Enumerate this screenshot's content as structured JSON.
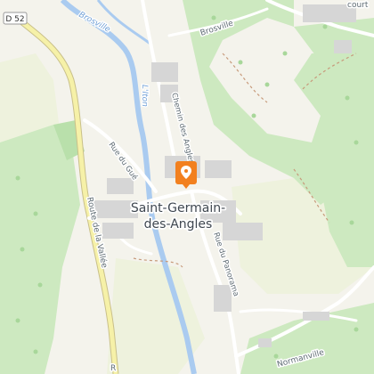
{
  "map": {
    "road_shield": "D 52",
    "place_name_line1": "Saint-Germain-",
    "place_name_line2": "des-Angles",
    "river_label": "L'Iton",
    "streets": {
      "chemin_des_angles": "Chemin des Angles",
      "rue_du_gue": "Rue du Gué",
      "route_de_la_vallee": "Route de la Vallée",
      "rue_du_panorama": "Rue du Panorama",
      "brosville_1": "Brosville",
      "brosville_2": "Brosville",
      "normanville": "Normanville",
      "top_right_partial": "court",
      "bottom_partial": "R"
    },
    "marker_icon": "map-pin-icon",
    "colors": {
      "background": "#f4f3ec",
      "forest": "#cde9c0",
      "meadow": "#eef2dd",
      "water": "#aacbf0",
      "road_yellow": "#f6f1a8",
      "building": "#d6d6d6",
      "marker": "#f2801f"
    }
  }
}
